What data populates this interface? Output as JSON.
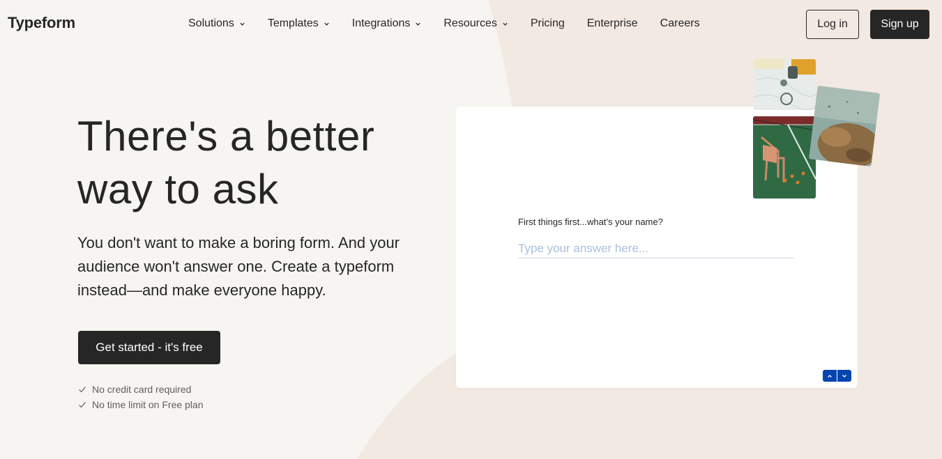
{
  "brand": {
    "logo": "Typeform",
    "dark": "#262627",
    "bg": "#f7f5f1",
    "accent_blob": "#f2e9e2",
    "form_accent": "#0445af"
  },
  "nav": {
    "items": [
      {
        "label": "Solutions",
        "has_dropdown": true
      },
      {
        "label": "Templates",
        "has_dropdown": true
      },
      {
        "label": "Integrations",
        "has_dropdown": true
      },
      {
        "label": "Resources",
        "has_dropdown": true
      },
      {
        "label": "Pricing",
        "has_dropdown": false
      },
      {
        "label": "Enterprise",
        "has_dropdown": false
      },
      {
        "label": "Careers",
        "has_dropdown": false
      }
    ],
    "login": "Log in",
    "signup": "Sign up"
  },
  "hero": {
    "title_line1": "There's a better",
    "title_line2": "way to ask",
    "subtitle": "You don't want to make a boring form. And your audience won't answer one. Create a typeform instead—and make everyone happy.",
    "cta": "Get started - it's free",
    "checks": [
      "No credit card required",
      "No time limit on Free plan"
    ]
  },
  "form_preview": {
    "question": "First things first...what’s your name?",
    "placeholder": "Type your answer here...",
    "icons": [
      "chevron-up-icon",
      "chevron-down-icon"
    ]
  }
}
